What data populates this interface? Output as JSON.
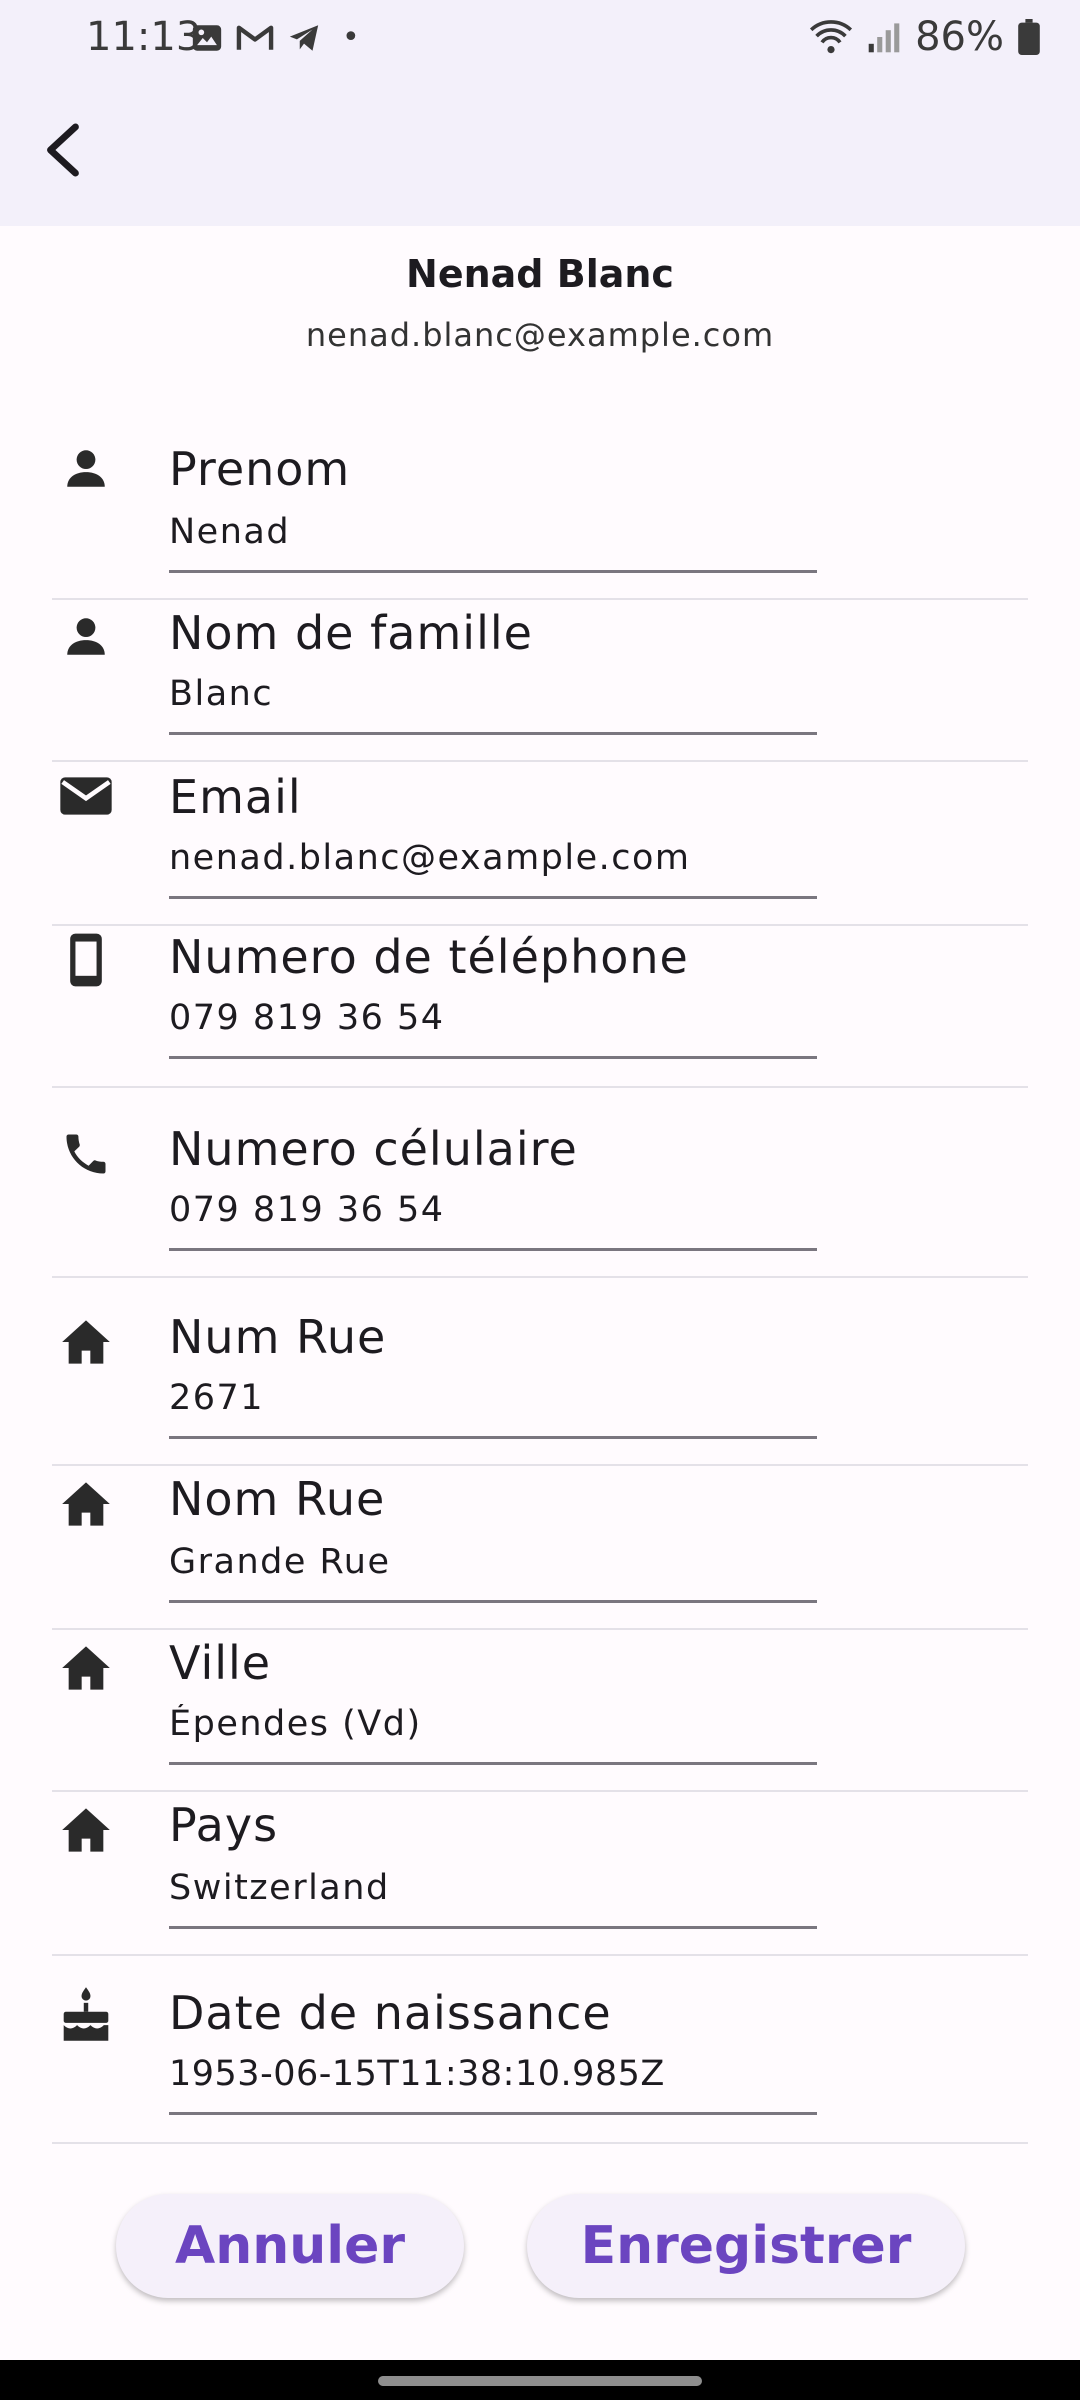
{
  "status": {
    "time": "11:13",
    "dot": "•",
    "battery": "86%"
  },
  "header": {
    "name": "Nenad Blanc",
    "email": "nenad.blanc@example.com"
  },
  "fields": [
    {
      "label": "Prenom",
      "value": "Nenad",
      "icon": "person-icon"
    },
    {
      "label": "Nom de famille",
      "value": "Blanc",
      "icon": "person-icon"
    },
    {
      "label": "Email",
      "value": "nenad.blanc@example.com",
      "icon": "mail-icon"
    },
    {
      "label": "Numero de téléphone",
      "value": "079 819 36 54",
      "icon": "smartphone-icon"
    },
    {
      "label": "Numero célulaire",
      "value": "079 819 36 54",
      "icon": "phone-icon"
    },
    {
      "label": "Num Rue",
      "value": "2671",
      "icon": "home-icon"
    },
    {
      "label": "Nom Rue",
      "value": "Grande Rue",
      "icon": "home-icon"
    },
    {
      "label": "Ville",
      "value": "Épendes (Vd)",
      "icon": "home-icon"
    },
    {
      "label": "Pays",
      "value": "Switzerland",
      "icon": "home-icon"
    },
    {
      "label": "Date de naissance",
      "value": "1953-06-15T11:38:10.985Z",
      "icon": "cake-icon"
    }
  ],
  "actions": {
    "cancel": "Annuler",
    "save": "Enregistrer"
  },
  "colors": {
    "accent": "#6b45c0",
    "appbar": "#f3f0fa",
    "background": "#fffbfe"
  }
}
